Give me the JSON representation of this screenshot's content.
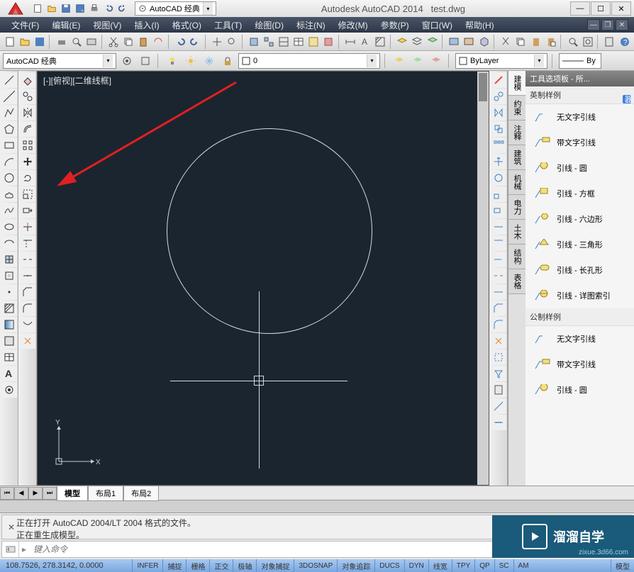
{
  "titlebar": {
    "app": "Autodesk AutoCAD 2014",
    "file": "test.dwg",
    "workspace_gear": "AutoCAD 经典"
  },
  "menu": {
    "items": [
      "文件(F)",
      "编辑(E)",
      "视图(V)",
      "插入(I)",
      "格式(O)",
      "工具(T)",
      "绘图(D)",
      "标注(N)",
      "修改(M)",
      "参数(P)",
      "窗口(W)",
      "帮助(H)"
    ]
  },
  "workspace": {
    "combo": "AutoCAD 经典",
    "layer_state": "0",
    "layer_combo": "ByLayer",
    "by_label": "By"
  },
  "viewport": {
    "label": "[-][俯视][二维线框]",
    "ucs_x": "X",
    "ucs_y": "Y"
  },
  "tabs": {
    "model": "模型",
    "layout1": "布局1",
    "layout2": "布局2"
  },
  "palette": {
    "title": "工具选项板 - 所...",
    "tabs": [
      "建模",
      "约束",
      "注释",
      "建筑",
      "机械",
      "电力",
      "土木",
      "结构",
      "表格"
    ],
    "section1": "英制样例",
    "section2": "公制样例",
    "items1": [
      "无文字引线",
      "带文字引线",
      "引线 - 圆",
      "引线 - 方框",
      "引线 - 六边形",
      "引线 - 三角形",
      "引线 - 长孔形",
      "引线 - 详图索引"
    ],
    "items2": [
      "无文字引线",
      "带文字引线",
      "引线 - 圆"
    ]
  },
  "cmd": {
    "line1": "正在打开 AutoCAD 2004/LT 2004 格式的文件。",
    "line2": "正在重生成模型。",
    "placeholder": "键入命令"
  },
  "status": {
    "coord": "108.7526, 278.3142, 0.0000",
    "buttons": [
      "INFER",
      "捕捉",
      "栅格",
      "正交",
      "极轴",
      "对象捕捉",
      "3DOSNAP",
      "对象追踪",
      "DUCS",
      "DYN",
      "线宽",
      "TPY",
      "QP",
      "SC",
      "AM"
    ],
    "right": "模型"
  },
  "watermark": {
    "text": "溜溜自学",
    "sub": "zixue.3d66.com"
  }
}
